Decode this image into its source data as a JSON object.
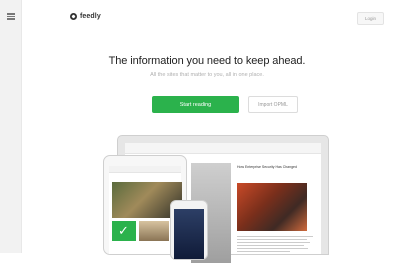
{
  "header": {
    "brand_name": "feedly",
    "login_label": "Login"
  },
  "hero": {
    "headline": "The information you need to keep ahead.",
    "subheadline": "All the sites that matter to you, all in one place."
  },
  "actions": {
    "start_reading_label": "Start reading",
    "import_opml_label": "Import OPML"
  },
  "illustration": {
    "article_title": "How Enterprise Security Has Changed"
  },
  "colors": {
    "accent_green": "#2bb24c",
    "sidebar_bg": "#f2f2f2"
  },
  "icons": {
    "menu": "hamburger-menu-icon",
    "logo": "feedly-logo-icon",
    "check": "check-icon"
  }
}
